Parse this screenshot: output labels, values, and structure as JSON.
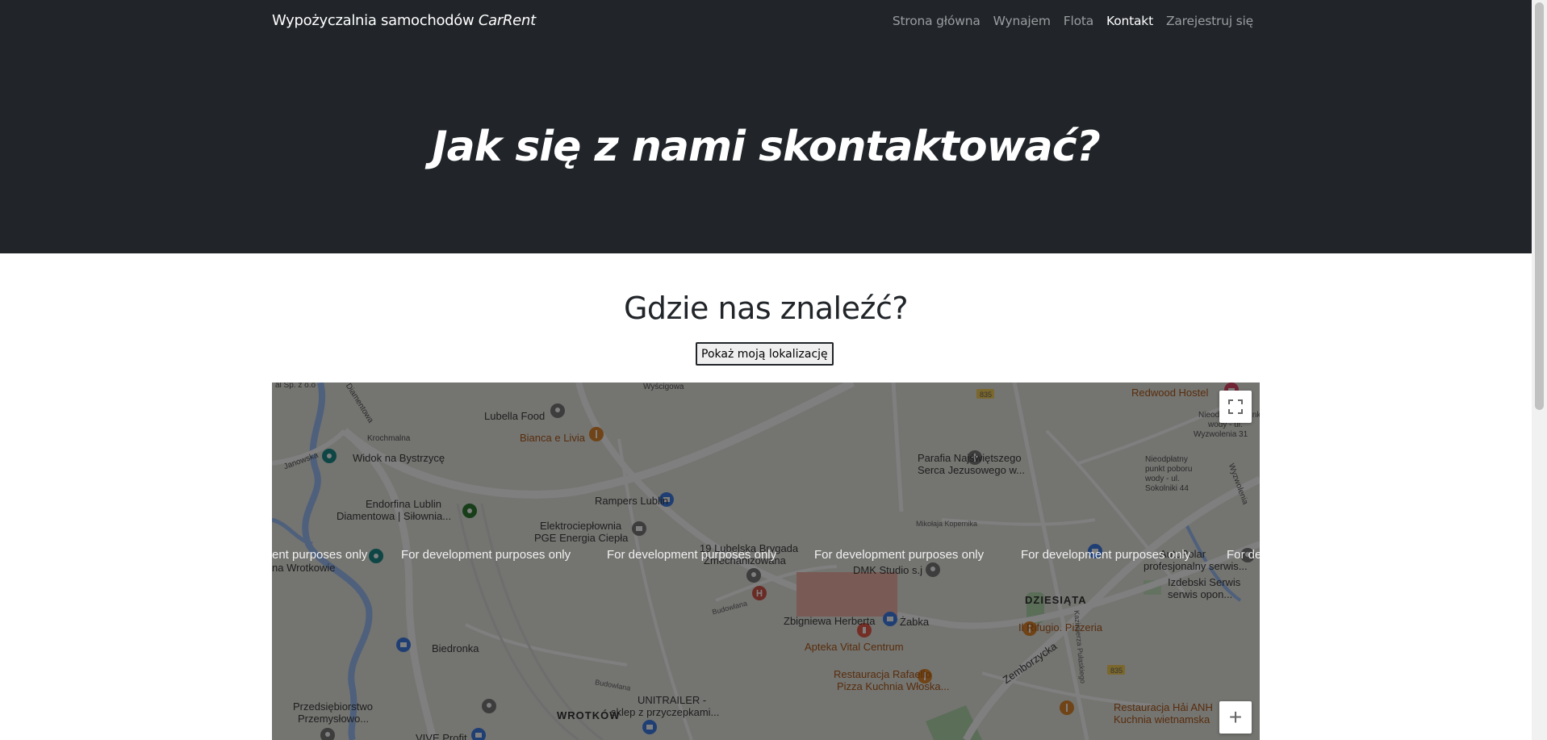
{
  "navbar": {
    "brand_text": "Wypożyczalnia samochodów ",
    "brand_em": "CarRent",
    "links": [
      {
        "label": "Strona główna",
        "active": false
      },
      {
        "label": "Wynajem",
        "active": false
      },
      {
        "label": "Flota",
        "active": false
      },
      {
        "label": "Kontakt",
        "active": true
      },
      {
        "label": "Zarejestruj się",
        "active": false
      }
    ]
  },
  "hero": {
    "title": "Jak się z nami skontaktować?"
  },
  "section": {
    "title": "Gdzie nas znaleźć?",
    "locate_button": "Pokaż moją lokalizację"
  },
  "map": {
    "watermark": "For development purposes only",
    "watermark_partial_left": "ent purposes only",
    "watermark_partial_right": "For de",
    "zoom_in_label": "+",
    "labels": {
      "lubella": "Lubella Food",
      "bianca": "Bianca e Livia",
      "widok": "Widok na Bystrzycę",
      "janowska": "Janowska",
      "diamentowa": "Diamentowa",
      "endorfina_1": "Endorfina Lublin",
      "endorfina_2": "Diamentowa | Siłownia...",
      "rampers": "Rampers Lublin",
      "elektro_1": "Elektrociepłownia",
      "elektro_2": "PGE Energia Ciepła",
      "brygada_1": "19 Lubelska Brygada",
      "brygada_2": "Zmechanizowana",
      "dmk": "DMK Studio s.j",
      "parafia_1": "Parafia Najświętszego",
      "parafia_2": "Serca Jezusowego w...",
      "redwood": "Redwood Hostel",
      "nieodplatny_1": "Nieodpłatny punkt poboru",
      "nieodplatny_2": "wody - ul.",
      "nieodplatny_3": "Wyzwolenia 31",
      "nieodplatny2_1": "Nieodpłatny",
      "nieodplatny2_2": "punkt poboru",
      "nieodplatny2_3": "wody - ul.",
      "nieodplatny2_4": "Sokolniki 44",
      "autopolar_1": "AutoPolar",
      "autopolar_2": "profesjonalny serwis...",
      "izdebski_1": "Izdebski Serwis",
      "izdebski_2": "serwis opon...",
      "dziesiata": "DZIESIĄTA",
      "wrotkowie_1": "na Wrotkowie",
      "herberta": "Zbigniewa Herberta",
      "zabka": "Żabka",
      "apteka": "Apteka Vital Centrum",
      "rifugio": "Il Rifugio. Pizzeria",
      "biedronka": "Biedronka",
      "rafaello_1": "Restauracja Rafaello",
      "rafaello_2": "Pizza Kuchnia Włoska...",
      "unitrailer_1": "UNITRAILER -",
      "unitrailer_2": "sklep z przyczepkami...",
      "przedsiebiorstwo_1": "Przedsiębiorstwo",
      "przedsiebiorstwo_2": "Przemysłowo...",
      "wrotkow": "WROTKÓW",
      "hai_anh_1": "Restauracja Hải ANH",
      "hai_anh_2": "Kuchnia wietnamska",
      "vive": "VIVE Profit",
      "zemborzycka": "Zemborzycka",
      "mikolaja": "Mikołaja Kopernika",
      "kazimierza": "Kazimierza Pułaskiego",
      "wyzwolenia": "Wyzwolenia",
      "road_835": "835",
      "road_835b": "835",
      "wyscigowa": "Wyścigowa",
      "krochmalna": "Krochmalna",
      "budowlana": "Budowlana",
      "budowlana2": "Budowlana",
      "sp_zoo": "al Sp. z o.o"
    }
  }
}
